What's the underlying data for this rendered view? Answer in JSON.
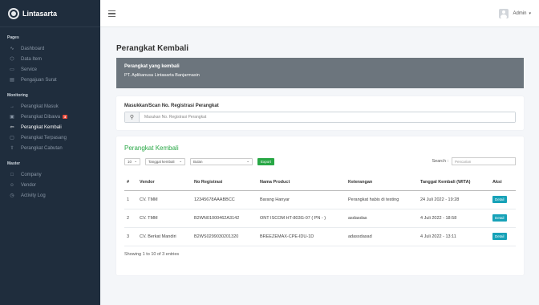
{
  "brand": {
    "name": "Lintasarta"
  },
  "sidebar": {
    "sections": [
      {
        "title": "Pages",
        "items": [
          {
            "label": "Dashboard",
            "icon": "activity-icon"
          },
          {
            "label": "Data Item",
            "icon": "box-icon"
          },
          {
            "label": "Service",
            "icon": "service-icon"
          },
          {
            "label": "Pengajuan Surat",
            "icon": "document-icon"
          }
        ]
      },
      {
        "title": "Monitoring",
        "items": [
          {
            "label": "Perangkat Masuk",
            "icon": "login-icon"
          },
          {
            "label": "Perangkat Dibawa",
            "icon": "briefcase-icon",
            "badge": "3"
          },
          {
            "label": "Perangkat Kembali",
            "icon": "return-icon",
            "active": true
          },
          {
            "label": "Perangkat Terpasang",
            "icon": "install-icon"
          },
          {
            "label": "Perangkat Cabutan",
            "icon": "upload-icon"
          }
        ]
      },
      {
        "title": "Master",
        "items": [
          {
            "label": "Company",
            "icon": "square-icon"
          },
          {
            "label": "Vendor",
            "icon": "users-icon"
          },
          {
            "label": "Activity Log",
            "icon": "log-icon"
          }
        ]
      }
    ]
  },
  "topbar": {
    "user": "Admin"
  },
  "page": {
    "title": "Perangkat Kembali",
    "info_title": "Perangkat yang kembali",
    "info_subtitle": "PT. Aplikanusa Lintasarta Banjarmasin",
    "scan_label": "Masukkan/Scan No. Registrasi Perangkat",
    "scan_placeholder": "Masukan No. Registrasi Perangkat"
  },
  "table_card": {
    "title": "Perangkat Kembali",
    "length": "10",
    "filter_date": "Tanggal kembali",
    "filter_month": "Bulan",
    "export_label": "Export",
    "search_label": "Search :",
    "search_placeholder": "Pencarian",
    "columns": [
      "#",
      "Vendor",
      "No Registrasi",
      "Nama Product",
      "Keterangan",
      "Tanggal Kembali (WITA)",
      "Aksi"
    ],
    "rows": [
      {
        "no": "1",
        "vendor": "CV. TMM",
        "reg": "12345678AAABBCC",
        "product": "Barang Hanyar",
        "ket": "Perangkat habis di testing",
        "tgl": "24 Juli 2022 - 19:28",
        "aksi": "Detail"
      },
      {
        "no": "2",
        "vendor": "CV. TMM",
        "reg": "B2WN01000462A3142",
        "product": "ONT ISCOM HT-803G-07 ( PN - )",
        "ket": "asdasdas",
        "tgl": "4 Juli 2022 - 18:58",
        "aksi": "Detail"
      },
      {
        "no": "3",
        "vendor": "CV. Berkat Mandiri",
        "reg": "B2WS0299030201320",
        "product": "BREEZEMAX-CPE-IDU-1D",
        "ket": "adassdasad",
        "tgl": "4 Juli 2022 - 13:11",
        "aksi": "Detail"
      }
    ],
    "footer": "Showing 1 to 10 of 3 entries"
  }
}
